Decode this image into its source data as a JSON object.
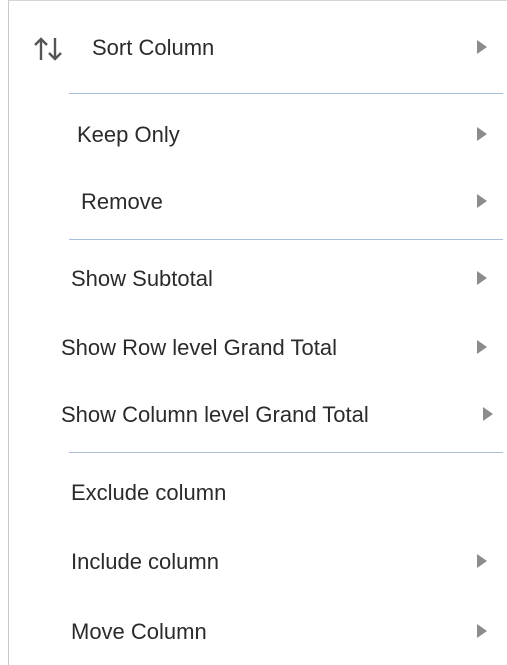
{
  "menu": {
    "items": [
      {
        "label": "Sort Column",
        "icon": "sort-icon",
        "submenu": true
      },
      {
        "label": "Keep Only",
        "submenu": true
      },
      {
        "label": "Remove",
        "submenu": true
      },
      {
        "label": "Show Subtotal",
        "submenu": true
      },
      {
        "label": "Show Row level Grand Total",
        "submenu": true
      },
      {
        "label": "Show Column level Grand Total",
        "submenu": true
      },
      {
        "label": "Exclude column",
        "submenu": false
      },
      {
        "label": "Include column",
        "submenu": true
      },
      {
        "label": "Move Column",
        "submenu": true
      }
    ]
  },
  "colors": {
    "text": "#2b2b2b",
    "arrow": "#8c8c8c",
    "divider": "#a7bfd8",
    "icon": "#555555"
  }
}
